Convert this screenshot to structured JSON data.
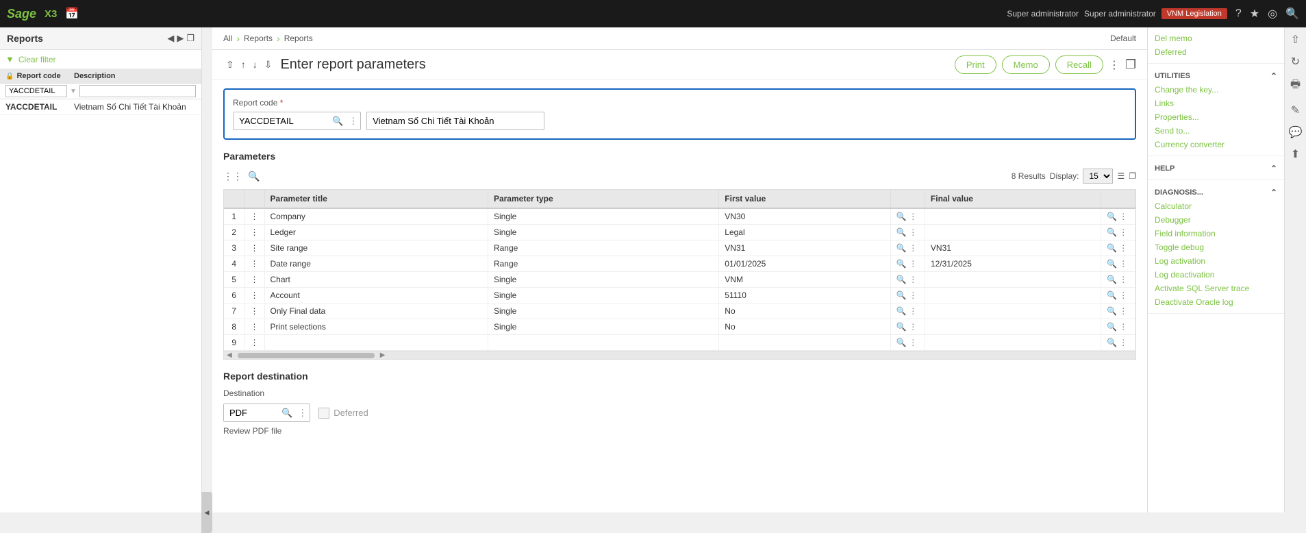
{
  "topNav": {
    "sageLogo": "Sage",
    "x3Label": "X3",
    "user1": "Super administrator",
    "user2": "Super administrator",
    "legislation": "VNM Legislation",
    "defaultLabel": "Default ▾"
  },
  "sidebar": {
    "title": "Reports",
    "clearFilter": "Clear filter",
    "columns": {
      "reportCode": "Report code",
      "description": "Description"
    },
    "filterCode": "YACCDETAIL",
    "filterDesc": "",
    "items": [
      {
        "code": "YACCDETAIL",
        "description": "Vietnam Số Chi Tiết Tài Khoản"
      }
    ]
  },
  "breadcrumb": {
    "all": "All",
    "reports1": "Reports",
    "reports2": "Reports"
  },
  "defaultLabel": "Default",
  "pageTitle": "Enter report parameters",
  "buttons": {
    "print": "Print",
    "memo": "Memo",
    "recall": "Recall"
  },
  "reportCode": {
    "label": "Report code",
    "required": true,
    "value": "YACCDETAIL",
    "description": "Vietnam Số Chi Tiết Tài Khoản"
  },
  "parameters": {
    "sectionTitle": "Parameters",
    "resultsCount": "8 Results",
    "displayLabel": "Display:",
    "displayValue": "15",
    "columns": {
      "paramTitle": "Parameter title",
      "paramType": "Parameter type",
      "firstValue": "First value",
      "finalValue": "Final value"
    },
    "rows": [
      {
        "num": 1,
        "title": "Company",
        "type": "Single",
        "firstValue": "VN30",
        "finalValue": ""
      },
      {
        "num": 2,
        "title": "Ledger",
        "type": "Single",
        "firstValue": "Legal",
        "finalValue": ""
      },
      {
        "num": 3,
        "title": "Site range",
        "type": "Range",
        "firstValue": "VN31",
        "finalValue": "VN31"
      },
      {
        "num": 4,
        "title": "Date range",
        "type": "Range",
        "firstValue": "01/01/2025",
        "finalValue": "12/31/2025"
      },
      {
        "num": 5,
        "title": "Chart",
        "type": "Single",
        "firstValue": "VNM",
        "finalValue": ""
      },
      {
        "num": 6,
        "title": "Account",
        "type": "Single",
        "firstValue": "51110",
        "finalValue": ""
      },
      {
        "num": 7,
        "title": "Only Final data",
        "type": "Single",
        "firstValue": "No",
        "finalValue": ""
      },
      {
        "num": 8,
        "title": "Print selections",
        "type": "Single",
        "firstValue": "No",
        "finalValue": ""
      },
      {
        "num": 9,
        "title": "",
        "type": "",
        "firstValue": "",
        "finalValue": ""
      }
    ]
  },
  "destination": {
    "sectionTitle": "Report destination",
    "destinationLabel": "Destination",
    "destinationValue": "PDF",
    "deferredLabel": "Deferred",
    "reviewLabel": "Review PDF file"
  },
  "rightPanel": {
    "delMemo": "Del memo",
    "deferred": "Deferred",
    "utilitiesTitle": "UTILITIES",
    "changeKey": "Change the key...",
    "links": "Links",
    "properties": "Properties...",
    "sendTo": "Send to...",
    "currencyConverter": "Currency converter",
    "helpTitle": "HELP",
    "diagnosisTitle": "DIAGNOSIS...",
    "calculator": "Calculator",
    "debugger": "Debugger",
    "fieldInformation": "Field information",
    "toggleDebug": "Toggle debug",
    "logActivation": "Log activation",
    "logDeactivation": "Log deactivation",
    "activateSQLTrace": "Activate SQL Server trace",
    "deactivateOracleLog": "Deactivate Oracle log"
  }
}
